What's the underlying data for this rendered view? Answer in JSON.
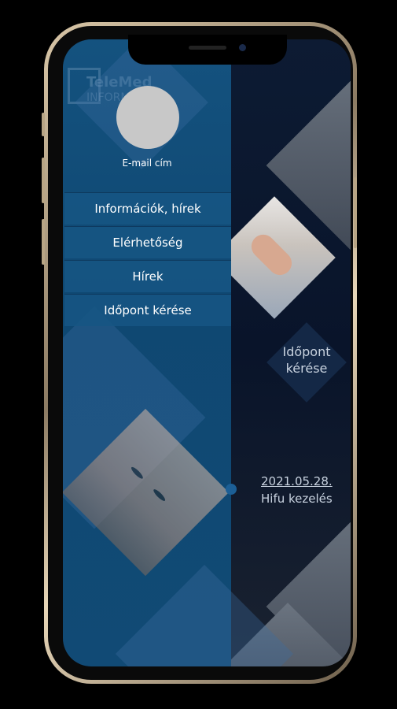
{
  "profile": {
    "email_label": "E-mail cím"
  },
  "logo": {
    "line1": "TeleMed",
    "line2": "INFORM"
  },
  "menu": [
    {
      "label": "Információk, hírek"
    },
    {
      "label": "Elérhetőség"
    },
    {
      "label": "Hírek"
    },
    {
      "label": "Időpont kérése"
    }
  ],
  "cta": {
    "line1": "Időpont",
    "line2": "kérése"
  },
  "news": {
    "date": "2021.05.28.",
    "title": "Hifu kezelés"
  },
  "colors": {
    "panel": "#14527f",
    "menu_item": "#165684",
    "dark_bg": "#0b1730",
    "text_light": "#c9d3e0"
  }
}
